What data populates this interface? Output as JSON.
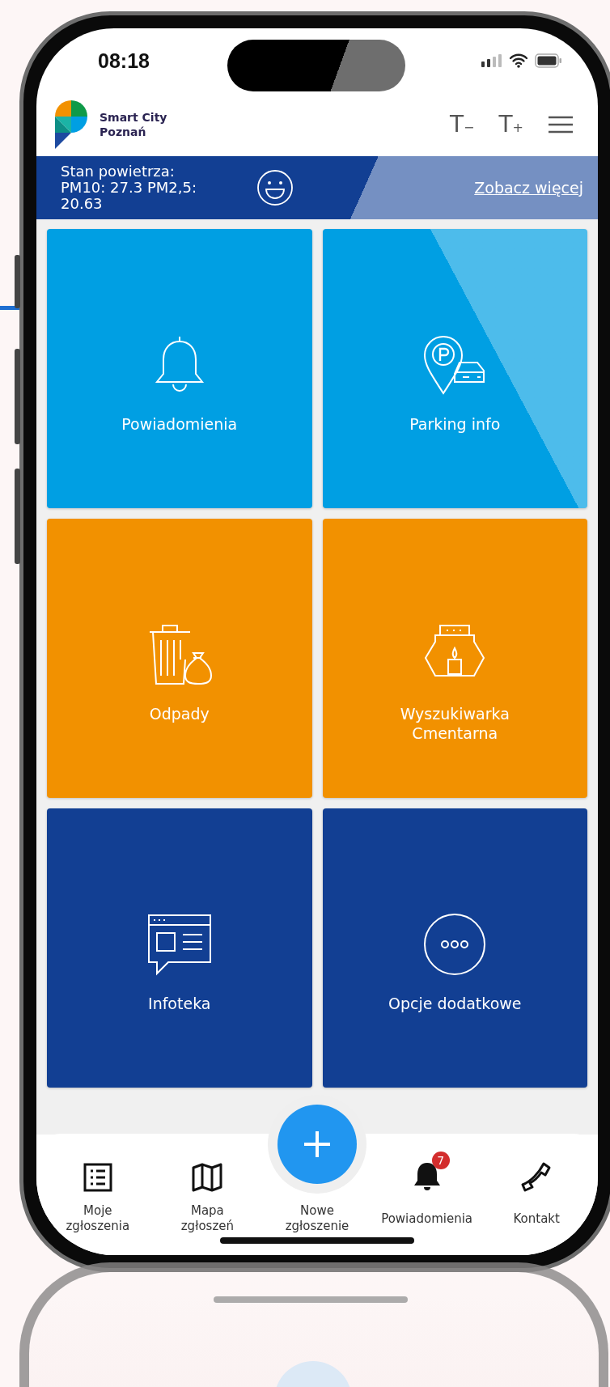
{
  "status_bar": {
    "time": "08:18"
  },
  "header": {
    "logo_lines": [
      "Smart City",
      "Poznań"
    ],
    "font_buttons": [
      {
        "letter": "T",
        "sign": "−"
      },
      {
        "letter": "T",
        "sign": "+"
      }
    ]
  },
  "air_quality": {
    "title": "Stan powietrza:",
    "readings": "PM10: 27.3  PM2,5: 20.63",
    "link": "Zobacz więcej"
  },
  "tiles": [
    {
      "label": "Powiadomienia",
      "color": "#009fe3"
    },
    {
      "label": "Parking info",
      "color": "#009fe3"
    },
    {
      "label": "Odpady",
      "color": "#f29100"
    },
    {
      "label": "Wyszukiwarka\nCmentarna",
      "color": "#f29100"
    },
    {
      "label": "Infoteka",
      "color": "#123f93"
    },
    {
      "label": "Opcje dodatkowe",
      "color": "#123f93"
    }
  ],
  "tab_bar": [
    {
      "label": "Moje\nzgłoszenia"
    },
    {
      "label": "Mapa\nzgłoszeń"
    },
    {
      "label": "Nowe\nzgłoszenie"
    },
    {
      "label": "Powiadomienia",
      "badge": "7"
    },
    {
      "label": "Kontakt"
    }
  ]
}
